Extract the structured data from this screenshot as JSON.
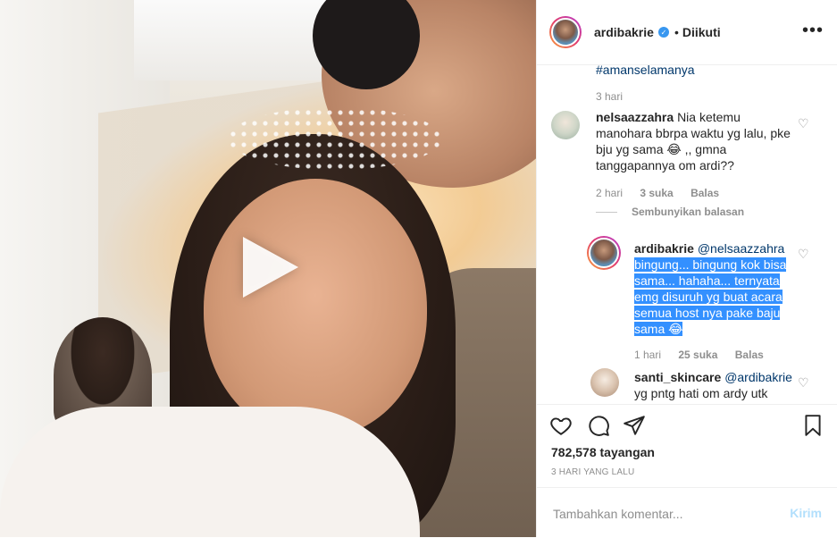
{
  "header": {
    "username": "ardibakrie",
    "verified_icon": "verified-badge-icon",
    "separator": "•",
    "follow_status": "Diikuti",
    "more_icon": "more-options-icon"
  },
  "caption": {
    "hashtag": "#amanselamanya",
    "time": "3 hari"
  },
  "comments": [
    {
      "username": "nelsaazzahra",
      "text": "Nia ketemu manohara bbrpa waktu yg lalu, pke bju yg sama 😂 ,, gmna tanggapannya om ardi??",
      "time": "2 hari",
      "likes": "3 suka",
      "reply": "Balas"
    }
  ],
  "hide_replies": "Sembunyikan balasan",
  "replies": [
    {
      "username": "ardibakrie",
      "mention": "@nelsaazzahra",
      "text": "bingung... bingung kok bisa sama... hahaha... ternyata emg disuruh yg buat acara semua host nya pake baju sama 😂",
      "time": "1 hari",
      "likes": "25 suka",
      "reply": "Balas"
    },
    {
      "username": "santi_skincare",
      "mention": "@ardibakrie",
      "text": "yg pntg hati om ardy utk"
    }
  ],
  "actions": {
    "like_icon": "heart-icon",
    "comment_icon": "comment-icon",
    "share_icon": "share-icon",
    "save_icon": "bookmark-icon"
  },
  "views": "782,578 tayangan",
  "date": "3 HARI YANG LALU",
  "add_comment": {
    "placeholder": "Tambahkan komentar...",
    "post_label": "Kirim"
  },
  "colors": {
    "link": "#00376b",
    "muted": "#8e8e8e",
    "highlight": "#3390ff",
    "verified": "#3897f0"
  }
}
